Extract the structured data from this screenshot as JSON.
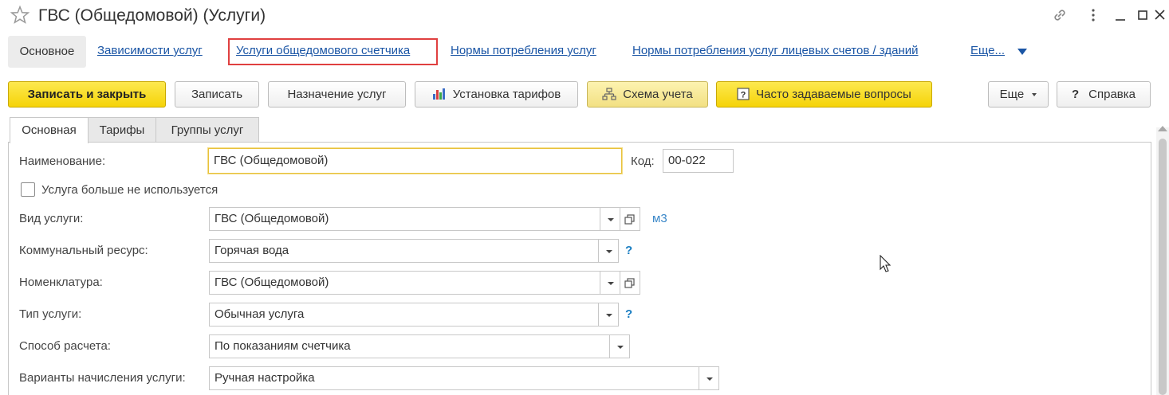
{
  "window": {
    "title": "ГВС (Общедомовой) (Услуги)",
    "icons": [
      "star-icon",
      "link-icon",
      "more-vertical-icon",
      "minimize-icon",
      "maximize-icon",
      "close-icon"
    ]
  },
  "nav": {
    "active": "Основное",
    "links": [
      "Зависимости услуг",
      "Услуги общедомового счетчика",
      "Нормы потребления услуг",
      "Нормы потребления услуг лицевых счетов / зданий",
      "Еще..."
    ],
    "highlight_color": "#e04040"
  },
  "toolbar": {
    "save_close": "Записать и закрыть",
    "save": "Записать",
    "assign": "Назначение услуг",
    "tariffs": "Установка тарифов",
    "scheme": "Схема учета",
    "faq": "Часто задаваемые вопросы",
    "more": "Еще",
    "help": "Справка",
    "help_glyph": "?"
  },
  "tabs": [
    "Основная",
    "Тарифы",
    "Группы услуг"
  ],
  "form": {
    "name_label": "Наименование:",
    "name_value": "ГВС (Общедомовой)",
    "code_label": "Код:",
    "code_value": "00-022",
    "not_used_label": "Услуга больше не используется",
    "not_used_checked": false,
    "service_type_label": "Вид услуги:",
    "service_type_value": "ГВС (Общедомовой)",
    "unit": "м3",
    "resource_label": "Коммунальный ресурс:",
    "resource_value": "Горячая вода",
    "nomenclature_label": "Номенклатура:",
    "nomenclature_value": "ГВС (Общедомовой)",
    "kind_label": "Тип услуги:",
    "kind_value": "Обычная услуга",
    "calc_label": "Способ расчета:",
    "calc_value": "По показаниям счетчика",
    "variants_label": "Варианты начисления услуги:",
    "variants_value": "Ручная настройка",
    "hint_glyph": "?"
  },
  "colors": {
    "link": "#1a55a5",
    "primary_button": "#f5d308",
    "focus_border": "#e8c13a"
  }
}
